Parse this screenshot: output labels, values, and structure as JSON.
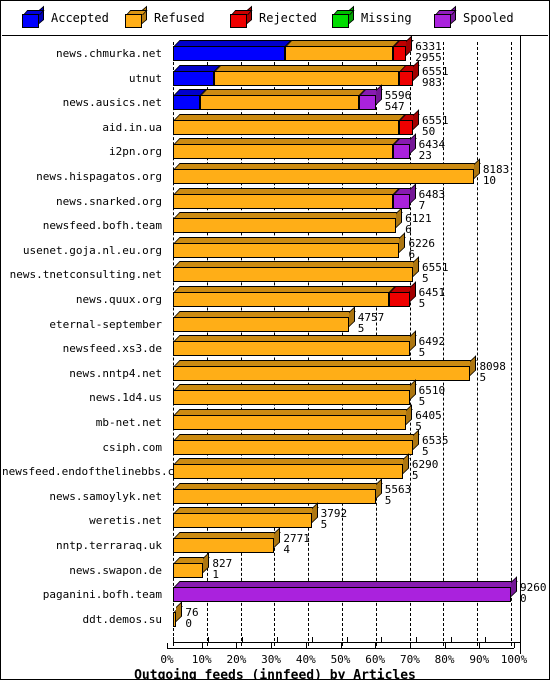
{
  "legend": {
    "items": [
      {
        "label": "Accepted",
        "color": "#0000ff",
        "icon": "cube-icon"
      },
      {
        "label": "Refused",
        "color": "#ffae17",
        "icon": "cube-icon"
      },
      {
        "label": "Rejected",
        "color": "#ee0000",
        "icon": "cube-icon"
      },
      {
        "label": "Missing",
        "color": "#00dd00",
        "icon": "cube-icon"
      },
      {
        "label": "Spooled",
        "color": "#aa22dd",
        "icon": "cube-icon"
      }
    ]
  },
  "chart_data": {
    "type": "bar",
    "orientation": "horizontal",
    "stacked": true,
    "title": "Outgoing feeds (innfeed) by Articles",
    "xlabel": "Outgoing feeds (innfeed) by Articles",
    "ylabel": "",
    "xlim": [
      0,
      100
    ],
    "xticks": [
      "0%",
      "10%",
      "20%",
      "30%",
      "40%",
      "50%",
      "60%",
      "70%",
      "80%",
      "90%",
      "100%"
    ],
    "grid": true,
    "legend_position": "top",
    "series": [
      {
        "name": "Accepted",
        "color": "#0000ff"
      },
      {
        "name": "Refused",
        "color": "#ffae17"
      },
      {
        "name": "Rejected",
        "color": "#ee0000"
      },
      {
        "name": "Missing",
        "color": "#00dd00"
      },
      {
        "name": "Spooled",
        "color": "#aa22dd"
      }
    ],
    "categories": [
      "news.chmurka.net",
      "utnut",
      "news.ausics.net",
      "aid.in.ua",
      "i2pn.org",
      "news.hispagatos.org",
      "news.snarked.org",
      "newsfeed.bofh.team",
      "usenet.goja.nl.eu.org",
      "news.tnetconsulting.net",
      "news.quux.org",
      "eternal-september",
      "newsfeed.xs3.de",
      "news.nntp4.net",
      "news.1d4.us",
      "mb-net.net",
      "csiph.com",
      "newsfeed.endofthelinebbs.com",
      "news.samoylyk.net",
      "weretis.net",
      "nntp.terraraq.uk",
      "news.swapon.de",
      "paganini.bofh.team",
      "ddt.demos.su"
    ],
    "rows": [
      {
        "category": "news.chmurka.net",
        "label_top": "6331",
        "label_bottom": "2955",
        "total_pct": 69,
        "segments": [
          {
            "series": "Accepted",
            "pct": 33
          },
          {
            "series": "Refused",
            "pct": 32
          },
          {
            "series": "Rejected",
            "pct": 4
          }
        ]
      },
      {
        "category": "utnut",
        "label_top": "6551",
        "label_bottom": "983",
        "total_pct": 71,
        "segments": [
          {
            "series": "Accepted",
            "pct": 12
          },
          {
            "series": "Refused",
            "pct": 55
          },
          {
            "series": "Rejected",
            "pct": 4
          }
        ]
      },
      {
        "category": "news.ausics.net",
        "label_top": "5596",
        "label_bottom": "547",
        "total_pct": 60,
        "segments": [
          {
            "series": "Accepted",
            "pct": 8
          },
          {
            "series": "Refused",
            "pct": 47
          },
          {
            "series": "Spooled",
            "pct": 5
          }
        ]
      },
      {
        "category": "aid.in.ua",
        "label_top": "6551",
        "label_bottom": "50",
        "total_pct": 71,
        "segments": [
          {
            "series": "Refused",
            "pct": 67
          },
          {
            "series": "Rejected",
            "pct": 4
          }
        ]
      },
      {
        "category": "i2pn.org",
        "label_top": "6434",
        "label_bottom": "23",
        "total_pct": 70,
        "segments": [
          {
            "series": "Refused",
            "pct": 65
          },
          {
            "series": "Spooled",
            "pct": 5
          }
        ]
      },
      {
        "category": "news.hispagatos.org",
        "label_top": "8183",
        "label_bottom": "10",
        "total_pct": 89,
        "segments": [
          {
            "series": "Refused",
            "pct": 89
          }
        ]
      },
      {
        "category": "news.snarked.org",
        "label_top": "6483",
        "label_bottom": "7",
        "total_pct": 70,
        "segments": [
          {
            "series": "Refused",
            "pct": 65
          },
          {
            "series": "Spooled",
            "pct": 5
          }
        ]
      },
      {
        "category": "newsfeed.bofh.team",
        "label_top": "6121",
        "label_bottom": "6",
        "total_pct": 66,
        "segments": [
          {
            "series": "Refused",
            "pct": 66
          }
        ]
      },
      {
        "category": "usenet.goja.nl.eu.org",
        "label_top": "6226",
        "label_bottom": "6",
        "total_pct": 67,
        "segments": [
          {
            "series": "Refused",
            "pct": 67
          }
        ]
      },
      {
        "category": "news.tnetconsulting.net",
        "label_top": "6551",
        "label_bottom": "5",
        "total_pct": 71,
        "segments": [
          {
            "series": "Refused",
            "pct": 71
          }
        ]
      },
      {
        "category": "news.quux.org",
        "label_top": "6451",
        "label_bottom": "5",
        "total_pct": 70,
        "segments": [
          {
            "series": "Refused",
            "pct": 64
          },
          {
            "series": "Rejected",
            "pct": 6
          }
        ]
      },
      {
        "category": "eternal-september",
        "label_top": "4757",
        "label_bottom": "5",
        "total_pct": 52,
        "segments": [
          {
            "series": "Refused",
            "pct": 52
          }
        ]
      },
      {
        "category": "newsfeed.xs3.de",
        "label_top": "6492",
        "label_bottom": "5",
        "total_pct": 70,
        "segments": [
          {
            "series": "Refused",
            "pct": 70
          }
        ]
      },
      {
        "category": "news.nntp4.net",
        "label_top": "8098",
        "label_bottom": "5",
        "total_pct": 88,
        "segments": [
          {
            "series": "Refused",
            "pct": 88
          }
        ]
      },
      {
        "category": "news.1d4.us",
        "label_top": "6510",
        "label_bottom": "5",
        "total_pct": 70,
        "segments": [
          {
            "series": "Refused",
            "pct": 70
          }
        ]
      },
      {
        "category": "mb-net.net",
        "label_top": "6405",
        "label_bottom": "5",
        "total_pct": 69,
        "segments": [
          {
            "series": "Refused",
            "pct": 69
          }
        ]
      },
      {
        "category": "csiph.com",
        "label_top": "6535",
        "label_bottom": "5",
        "total_pct": 71,
        "segments": [
          {
            "series": "Refused",
            "pct": 71
          }
        ]
      },
      {
        "category": "newsfeed.endofthelinebbs.com",
        "label_top": "6290",
        "label_bottom": "5",
        "total_pct": 68,
        "segments": [
          {
            "series": "Refused",
            "pct": 68
          }
        ]
      },
      {
        "category": "news.samoylyk.net",
        "label_top": "5563",
        "label_bottom": "5",
        "total_pct": 60,
        "segments": [
          {
            "series": "Refused",
            "pct": 60
          }
        ]
      },
      {
        "category": "weretis.net",
        "label_top": "3792",
        "label_bottom": "5",
        "total_pct": 41,
        "segments": [
          {
            "series": "Refused",
            "pct": 41
          }
        ]
      },
      {
        "category": "nntp.terraraq.uk",
        "label_top": "2771",
        "label_bottom": "4",
        "total_pct": 30,
        "segments": [
          {
            "series": "Refused",
            "pct": 30
          }
        ]
      },
      {
        "category": "news.swapon.de",
        "label_top": "827",
        "label_bottom": "1",
        "total_pct": 9,
        "segments": [
          {
            "series": "Refused",
            "pct": 9
          }
        ]
      },
      {
        "category": "paganini.bofh.team",
        "label_top": "9260",
        "label_bottom": "0",
        "total_pct": 100,
        "segments": [
          {
            "series": "Spooled",
            "pct": 100
          }
        ]
      },
      {
        "category": "ddt.demos.su",
        "label_top": "76",
        "label_bottom": "0",
        "total_pct": 1,
        "segments": [
          {
            "series": "Refused",
            "pct": 1
          }
        ]
      }
    ]
  }
}
